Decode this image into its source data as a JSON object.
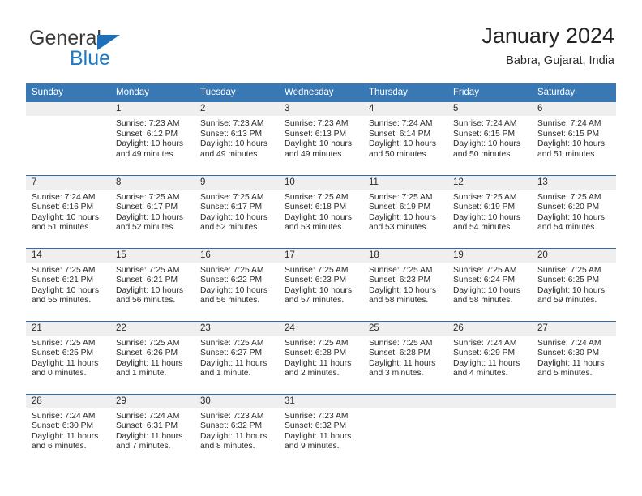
{
  "brand": {
    "name_part1": "General",
    "name_part2": "Blue",
    "accent_color": "#2079c4",
    "triangle_color": "#1c6fb8"
  },
  "header": {
    "title": "January 2024",
    "subtitle": "Babra, Gujarat, India"
  },
  "colors": {
    "header_row_bg": "#3879b5",
    "header_row_text": "#ffffff",
    "daynum_band_bg": "#efefef",
    "week_divider": "#2f6ca8",
    "body_text": "#2b2b2b"
  },
  "weekday_headers": [
    "Sunday",
    "Monday",
    "Tuesday",
    "Wednesday",
    "Thursday",
    "Friday",
    "Saturday"
  ],
  "weeks": [
    [
      {
        "day": "",
        "sunrise": "",
        "sunset": "",
        "daylight_line1": "",
        "daylight_line2": ""
      },
      {
        "day": "1",
        "sunrise": "Sunrise: 7:23 AM",
        "sunset": "Sunset: 6:12 PM",
        "daylight_line1": "Daylight: 10 hours",
        "daylight_line2": "and 49 minutes."
      },
      {
        "day": "2",
        "sunrise": "Sunrise: 7:23 AM",
        "sunset": "Sunset: 6:13 PM",
        "daylight_line1": "Daylight: 10 hours",
        "daylight_line2": "and 49 minutes."
      },
      {
        "day": "3",
        "sunrise": "Sunrise: 7:23 AM",
        "sunset": "Sunset: 6:13 PM",
        "daylight_line1": "Daylight: 10 hours",
        "daylight_line2": "and 49 minutes."
      },
      {
        "day": "4",
        "sunrise": "Sunrise: 7:24 AM",
        "sunset": "Sunset: 6:14 PM",
        "daylight_line1": "Daylight: 10 hours",
        "daylight_line2": "and 50 minutes."
      },
      {
        "day": "5",
        "sunrise": "Sunrise: 7:24 AM",
        "sunset": "Sunset: 6:15 PM",
        "daylight_line1": "Daylight: 10 hours",
        "daylight_line2": "and 50 minutes."
      },
      {
        "day": "6",
        "sunrise": "Sunrise: 7:24 AM",
        "sunset": "Sunset: 6:15 PM",
        "daylight_line1": "Daylight: 10 hours",
        "daylight_line2": "and 51 minutes."
      }
    ],
    [
      {
        "day": "7",
        "sunrise": "Sunrise: 7:24 AM",
        "sunset": "Sunset: 6:16 PM",
        "daylight_line1": "Daylight: 10 hours",
        "daylight_line2": "and 51 minutes."
      },
      {
        "day": "8",
        "sunrise": "Sunrise: 7:25 AM",
        "sunset": "Sunset: 6:17 PM",
        "daylight_line1": "Daylight: 10 hours",
        "daylight_line2": "and 52 minutes."
      },
      {
        "day": "9",
        "sunrise": "Sunrise: 7:25 AM",
        "sunset": "Sunset: 6:17 PM",
        "daylight_line1": "Daylight: 10 hours",
        "daylight_line2": "and 52 minutes."
      },
      {
        "day": "10",
        "sunrise": "Sunrise: 7:25 AM",
        "sunset": "Sunset: 6:18 PM",
        "daylight_line1": "Daylight: 10 hours",
        "daylight_line2": "and 53 minutes."
      },
      {
        "day": "11",
        "sunrise": "Sunrise: 7:25 AM",
        "sunset": "Sunset: 6:19 PM",
        "daylight_line1": "Daylight: 10 hours",
        "daylight_line2": "and 53 minutes."
      },
      {
        "day": "12",
        "sunrise": "Sunrise: 7:25 AM",
        "sunset": "Sunset: 6:19 PM",
        "daylight_line1": "Daylight: 10 hours",
        "daylight_line2": "and 54 minutes."
      },
      {
        "day": "13",
        "sunrise": "Sunrise: 7:25 AM",
        "sunset": "Sunset: 6:20 PM",
        "daylight_line1": "Daylight: 10 hours",
        "daylight_line2": "and 54 minutes."
      }
    ],
    [
      {
        "day": "14",
        "sunrise": "Sunrise: 7:25 AM",
        "sunset": "Sunset: 6:21 PM",
        "daylight_line1": "Daylight: 10 hours",
        "daylight_line2": "and 55 minutes."
      },
      {
        "day": "15",
        "sunrise": "Sunrise: 7:25 AM",
        "sunset": "Sunset: 6:21 PM",
        "daylight_line1": "Daylight: 10 hours",
        "daylight_line2": "and 56 minutes."
      },
      {
        "day": "16",
        "sunrise": "Sunrise: 7:25 AM",
        "sunset": "Sunset: 6:22 PM",
        "daylight_line1": "Daylight: 10 hours",
        "daylight_line2": "and 56 minutes."
      },
      {
        "day": "17",
        "sunrise": "Sunrise: 7:25 AM",
        "sunset": "Sunset: 6:23 PM",
        "daylight_line1": "Daylight: 10 hours",
        "daylight_line2": "and 57 minutes."
      },
      {
        "day": "18",
        "sunrise": "Sunrise: 7:25 AM",
        "sunset": "Sunset: 6:23 PM",
        "daylight_line1": "Daylight: 10 hours",
        "daylight_line2": "and 58 minutes."
      },
      {
        "day": "19",
        "sunrise": "Sunrise: 7:25 AM",
        "sunset": "Sunset: 6:24 PM",
        "daylight_line1": "Daylight: 10 hours",
        "daylight_line2": "and 58 minutes."
      },
      {
        "day": "20",
        "sunrise": "Sunrise: 7:25 AM",
        "sunset": "Sunset: 6:25 PM",
        "daylight_line1": "Daylight: 10 hours",
        "daylight_line2": "and 59 minutes."
      }
    ],
    [
      {
        "day": "21",
        "sunrise": "Sunrise: 7:25 AM",
        "sunset": "Sunset: 6:25 PM",
        "daylight_line1": "Daylight: 11 hours",
        "daylight_line2": "and 0 minutes."
      },
      {
        "day": "22",
        "sunrise": "Sunrise: 7:25 AM",
        "sunset": "Sunset: 6:26 PM",
        "daylight_line1": "Daylight: 11 hours",
        "daylight_line2": "and 1 minute."
      },
      {
        "day": "23",
        "sunrise": "Sunrise: 7:25 AM",
        "sunset": "Sunset: 6:27 PM",
        "daylight_line1": "Daylight: 11 hours",
        "daylight_line2": "and 1 minute."
      },
      {
        "day": "24",
        "sunrise": "Sunrise: 7:25 AM",
        "sunset": "Sunset: 6:28 PM",
        "daylight_line1": "Daylight: 11 hours",
        "daylight_line2": "and 2 minutes."
      },
      {
        "day": "25",
        "sunrise": "Sunrise: 7:25 AM",
        "sunset": "Sunset: 6:28 PM",
        "daylight_line1": "Daylight: 11 hours",
        "daylight_line2": "and 3 minutes."
      },
      {
        "day": "26",
        "sunrise": "Sunrise: 7:24 AM",
        "sunset": "Sunset: 6:29 PM",
        "daylight_line1": "Daylight: 11 hours",
        "daylight_line2": "and 4 minutes."
      },
      {
        "day": "27",
        "sunrise": "Sunrise: 7:24 AM",
        "sunset": "Sunset: 6:30 PM",
        "daylight_line1": "Daylight: 11 hours",
        "daylight_line2": "and 5 minutes."
      }
    ],
    [
      {
        "day": "28",
        "sunrise": "Sunrise: 7:24 AM",
        "sunset": "Sunset: 6:30 PM",
        "daylight_line1": "Daylight: 11 hours",
        "daylight_line2": "and 6 minutes."
      },
      {
        "day": "29",
        "sunrise": "Sunrise: 7:24 AM",
        "sunset": "Sunset: 6:31 PM",
        "daylight_line1": "Daylight: 11 hours",
        "daylight_line2": "and 7 minutes."
      },
      {
        "day": "30",
        "sunrise": "Sunrise: 7:23 AM",
        "sunset": "Sunset: 6:32 PM",
        "daylight_line1": "Daylight: 11 hours",
        "daylight_line2": "and 8 minutes."
      },
      {
        "day": "31",
        "sunrise": "Sunrise: 7:23 AM",
        "sunset": "Sunset: 6:32 PM",
        "daylight_line1": "Daylight: 11 hours",
        "daylight_line2": "and 9 minutes."
      },
      {
        "day": "",
        "sunrise": "",
        "sunset": "",
        "daylight_line1": "",
        "daylight_line2": ""
      },
      {
        "day": "",
        "sunrise": "",
        "sunset": "",
        "daylight_line1": "",
        "daylight_line2": ""
      },
      {
        "day": "",
        "sunrise": "",
        "sunset": "",
        "daylight_line1": "",
        "daylight_line2": ""
      }
    ]
  ]
}
